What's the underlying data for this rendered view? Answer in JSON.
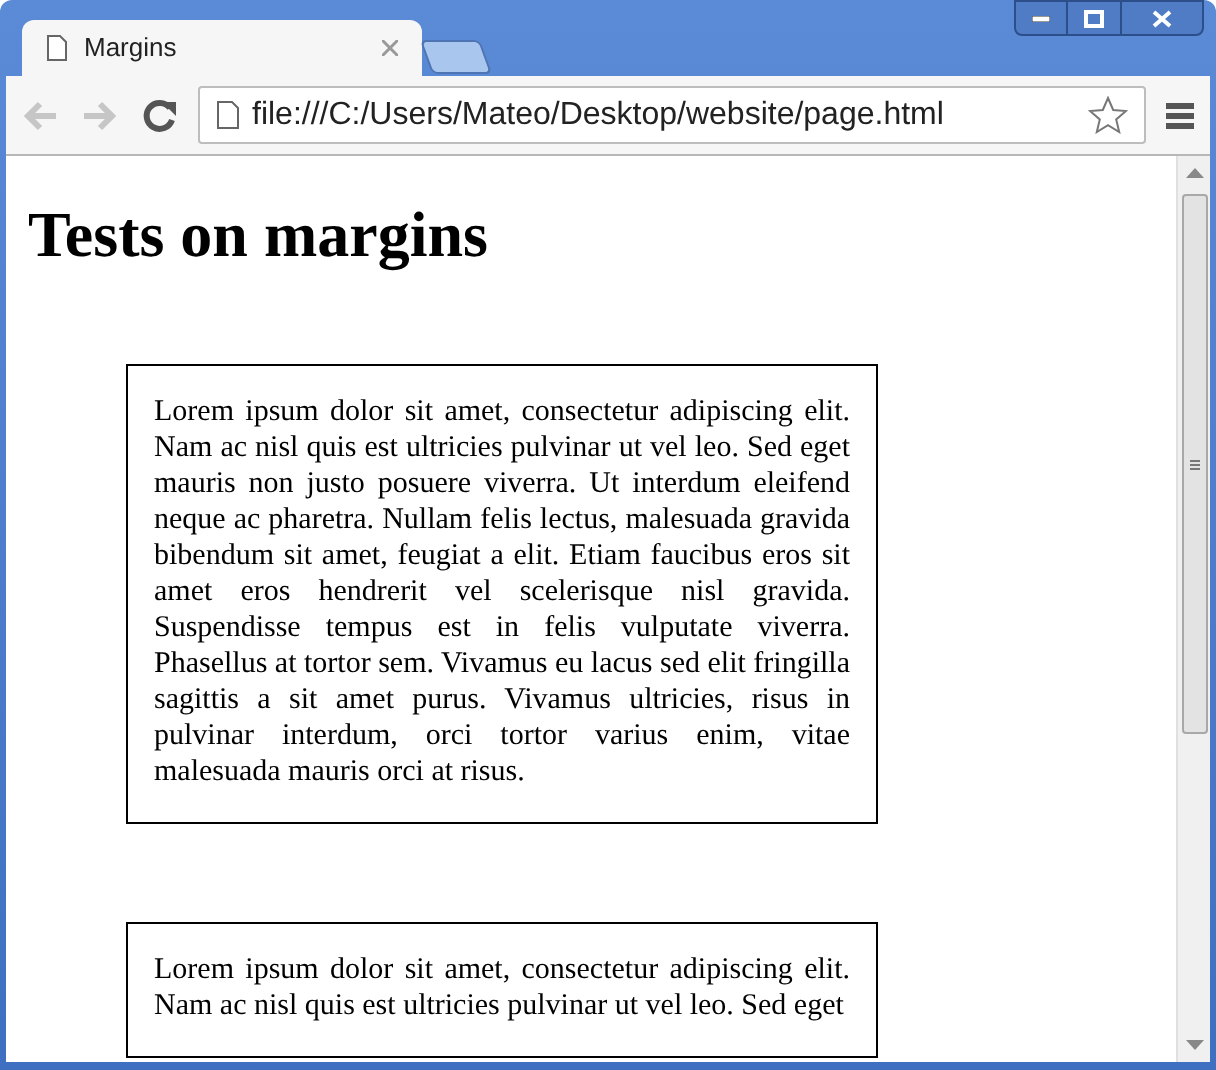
{
  "tabs": [
    {
      "label": "Margins",
      "selected": true
    }
  ],
  "address_bar": {
    "url": "file:///C:/Users/Mateo/Desktop/website/page.html"
  },
  "page": {
    "heading": "Tests on margins",
    "boxes": [
      {
        "text": "Lorem ipsum dolor sit amet, consectetur adipiscing elit. Nam ac nisl quis est ultricies pulvinar ut vel leo. Sed eget mauris non justo posuere viverra. Ut interdum eleifend neque ac pharetra. Nullam felis lectus, malesuada gravida bibendum sit amet, feugiat a elit. Etiam faucibus eros sit amet eros hendrerit vel scelerisque nisl gravida. Suspendisse tempus est in felis vulputate viverra. Phasellus at tortor sem. Vivamus eu lacus sed elit fringilla sagittis a sit amet purus. Vivamus ultricies, risus in pulvinar interdum, orci tortor varius enim, vitae malesuada mauris orci at risus."
      },
      {
        "text": "Lorem ipsum dolor sit amet, consectetur adipiscing elit. Nam ac nisl quis est ultricies pulvinar ut vel leo. Sed eget"
      }
    ]
  }
}
